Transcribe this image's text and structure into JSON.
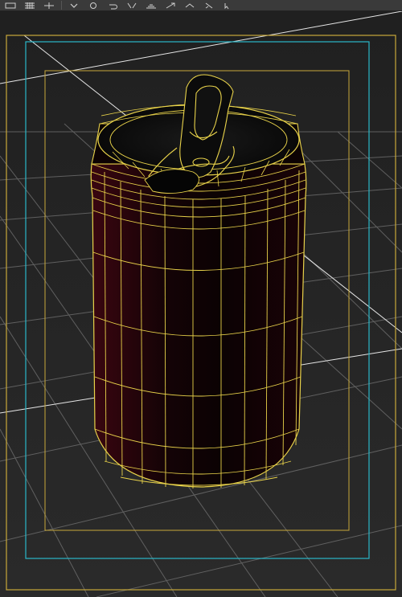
{
  "toolbar": {
    "buttons": [
      "move-icon",
      "grid-icon",
      "snap-icon",
      "dropdown-icon",
      "rotate-icon",
      "undo-icon",
      "mirror-icon",
      "align-icon",
      "scale-icon",
      "layer-icon",
      "pick-icon",
      "select-icon"
    ]
  },
  "viewport": {
    "background": "#262626",
    "grid_color": "#6a6a6a",
    "safe_frame_outer": "#c8a83a",
    "safe_frame_inner": "#2ab7c9",
    "wireframe_color": "#e8d24a",
    "object_fill": "#2a0508"
  }
}
